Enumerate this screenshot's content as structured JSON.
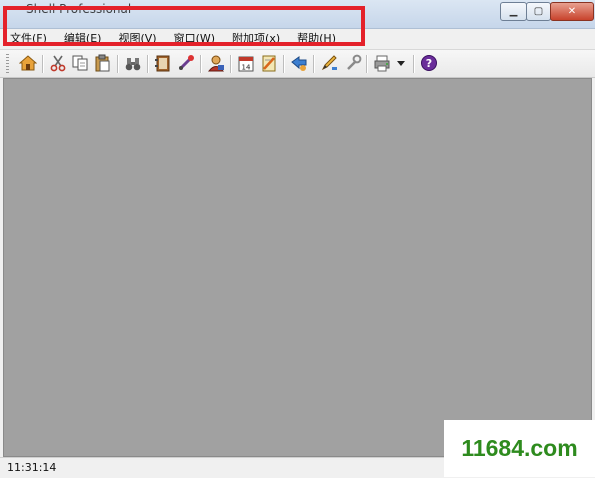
{
  "window": {
    "title": "Shell Professional"
  },
  "menu": {
    "items": [
      "文件(F)",
      "编辑(E)",
      "视图(V)",
      "窗口(W)",
      "附加项(x)",
      "帮助(H)"
    ]
  },
  "toolbar": {
    "buttons": [
      "home-icon",
      "cut-icon",
      "copy-icon",
      "paste-icon",
      "binoculars-icon",
      "address-book-icon",
      "link-icon",
      "user-icon",
      "calendar-icon",
      "task-icon",
      "share-icon",
      "pencil-icon",
      "wrench-icon",
      "printer-icon",
      "dropdown-arrow-icon",
      "help-icon"
    ],
    "calendar_day": "14",
    "help_symbol": "?"
  },
  "status": {
    "time": "11:31:14"
  },
  "watermark": {
    "text": "11684.com"
  },
  "colors": {
    "highlight": "#e4212a",
    "workspace": "#a1a1a1",
    "watermark": "#2e8b1e"
  }
}
